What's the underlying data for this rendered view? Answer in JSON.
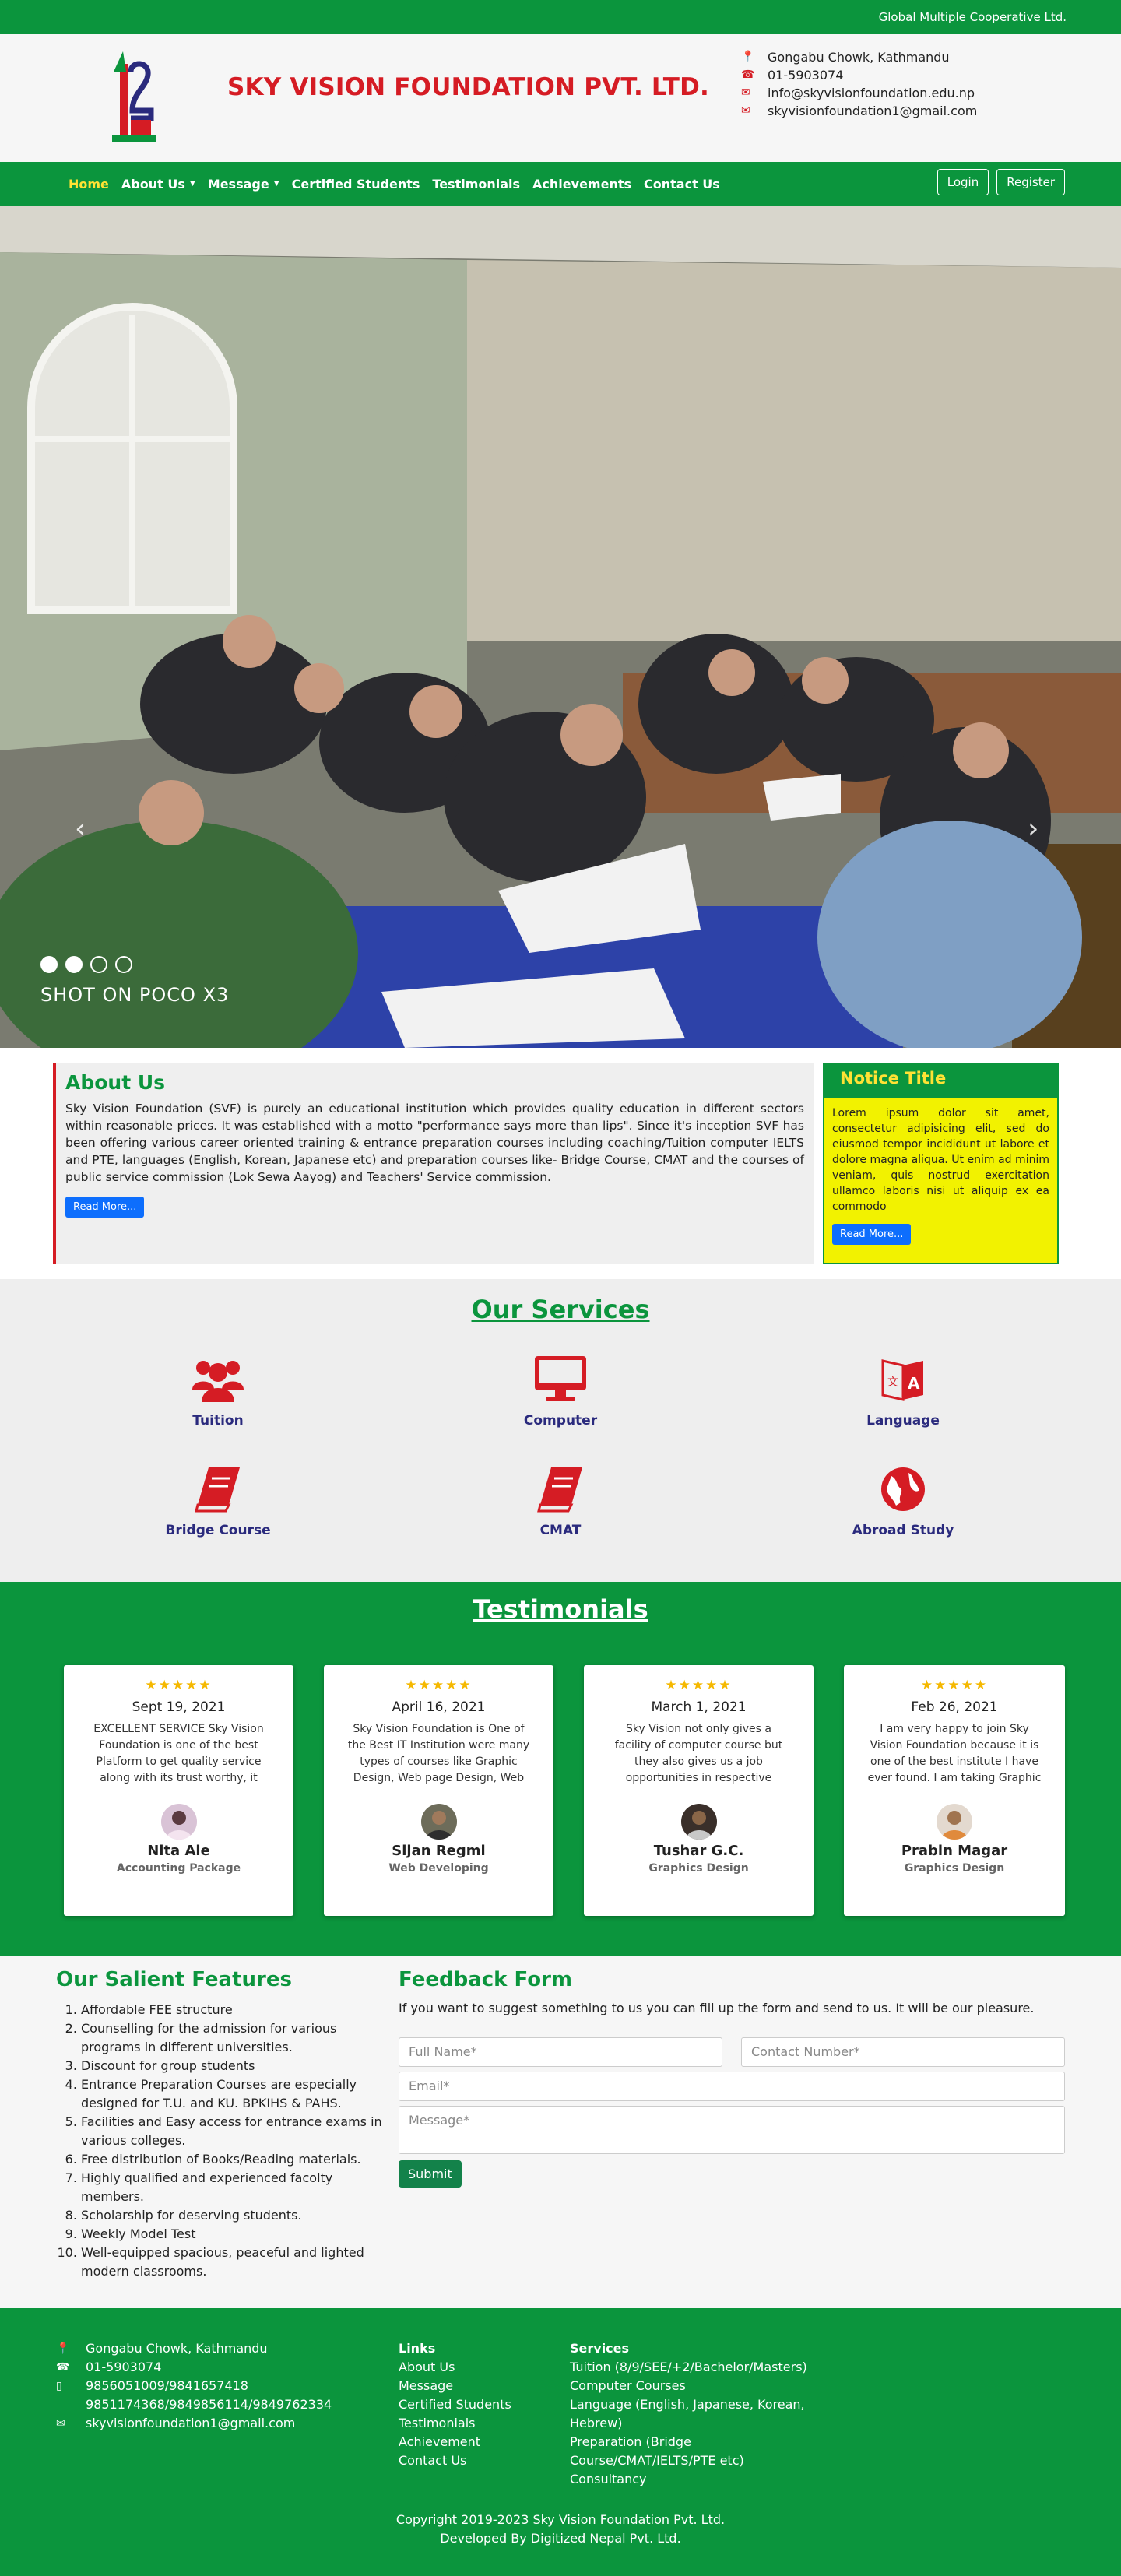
{
  "topbar": {
    "text": "Global Multiple Cooperative Ltd."
  },
  "header": {
    "brand": "SKY VISION FOUNDATION PVT. LTD.",
    "contacts": {
      "address": "Gongabu Chowk, Kathmandu",
      "phone": "01-5903074",
      "email1": "info@skyvisionfoundation.edu.np",
      "email2": "skyvisionfoundation1@gmail.com"
    }
  },
  "nav": {
    "home": "Home",
    "about": "About Us",
    "message": "Message",
    "certified": "Certified Students",
    "testimonials": "Testimonials",
    "achievements": "Achievements",
    "contact": "Contact Us",
    "login": "Login",
    "register": "Register"
  },
  "hero": {
    "caption": "SHOT ON POCO X3",
    "slides": 4,
    "active_slides": 2
  },
  "about": {
    "title": "About Us",
    "text": "Sky Vision Foundation (SVF) is purely an educational institution which provides quality education in different sectors within reasonable prices. It was established with a motto \"performance says more than lips\". Since it's inception SVF has been offering various career oriented training & entrance preparation courses including coaching/Tuition computer IELTS and PTE, languages (English, Korean, Japanese etc) and preparation courses like- Bridge Course, CMAT and the courses of public service commission (Lok Sewa Aayog) and Teachers' Service commission.",
    "button": "Read More..."
  },
  "notice": {
    "title": "Notice Title",
    "text": "Lorem ipsum dolor sit amet, consectetur adipisicing elit, sed do eiusmod tempor incididunt ut labore et dolore magna aliqua. Ut enim ad minim veniam, quis nostrud exercitation ullamco laboris nisi ut aliquip ex ea commodo",
    "button": "Read More..."
  },
  "services": {
    "title": "Our Services",
    "items": [
      {
        "label": "Tuition",
        "icon": "users-icon"
      },
      {
        "label": "Computer",
        "icon": "desktop-icon"
      },
      {
        "label": "Language",
        "icon": "language-icon"
      },
      {
        "label": "Bridge Course",
        "icon": "book-icon"
      },
      {
        "label": "CMAT",
        "icon": "book-icon"
      },
      {
        "label": "Abroad Study",
        "icon": "globe-icon"
      }
    ]
  },
  "testimonials": {
    "title": "Testimonials",
    "stars": "★★★★★",
    "items": [
      {
        "date": "Sept 19, 2021",
        "text": "EXCELLENT SERVICE Sky Vision Foundation is one of the best Platform to get quality service along with its trust worthy, it provides excellent learning",
        "name": "Nita Ale",
        "role": "Accounting Package"
      },
      {
        "date": "April 16, 2021",
        "text": "Sky Vision Foundation is One of the Best IT Institution were many types of courses like Graphic Design, Web page Design, Web Programming, Hardware &",
        "name": "Sijan Regmi",
        "role": "Web Developing"
      },
      {
        "date": "March 1, 2021",
        "text": "Sky Vision not only gives a facility of computer course but they also gives us a job opportunities in respective field..... Sooo I want to recommend my friends to take a",
        "name": "Tushar G.C.",
        "role": "Graphics Design"
      },
      {
        "date": "Feb 26, 2021",
        "text": "I am very happy to join Sky Vision Foundation because it is one of the best institute I have ever found. I am taking Graphic Designing Class in here and I can say that I am",
        "name": "Prabin Magar",
        "role": "Graphics Design"
      }
    ]
  },
  "features": {
    "title": "Our Salient Features",
    "items": [
      "Affordable FEE structure",
      "Counselling for the admission for various programs in different universities.",
      "Discount for group students",
      "Entrance Preparation Courses are especially designed for T.U. and KU. BPKIHS & PAHS.",
      "Facilities and Easy access for entrance exams in various colleges.",
      "Free distribution of Books/Reading materials.",
      "Highly qualified and experienced facolty members.",
      "Scholarship for deserving students.",
      "Weekly Model Test",
      "Well-equipped spacious, peaceful and lighted modern classrooms."
    ]
  },
  "feedback": {
    "title": "Feedback Form",
    "intro": "If you want to suggest something to us you can fill up the form and send to us. It will be our pleasure.",
    "name_ph": "Full Name*",
    "contact_ph": "Contact Number*",
    "email_ph": "Email*",
    "message_ph": "Message*",
    "submit": "Submit"
  },
  "footer": {
    "address": "Gongabu Chowk, Kathmandu",
    "phone": "01-5903074",
    "mobile1": "9856051009/9841657418",
    "mobile2": "9851174368/9849856114/9849762334",
    "email": "skyvisionfoundation1@gmail.com",
    "links_title": "Links",
    "links": [
      "About Us",
      "Message",
      "Certified Students",
      "Testimonials",
      "Achievement",
      "Contact Us"
    ],
    "services_title": "Services",
    "services": [
      "Tuition (8/9/SEE/+2/Bachelor/Masters)",
      "Computer Courses",
      "Language (English, Japanese, Korean, Hebrew)",
      "Preparation (Bridge Course/CMAT/IELTS/PTE etc)",
      "Consultancy"
    ],
    "copyright": "Copyright 2019-2023 Sky Vision Foundation Pvt. Ltd.",
    "developer": "Developed By Digitized Nepal Pvt. Ltd."
  },
  "colors": {
    "brand_green": "#0b953d",
    "brand_red": "#d51c24",
    "nav_active": "#ffe234",
    "notice_yellow": "#f2f200"
  }
}
